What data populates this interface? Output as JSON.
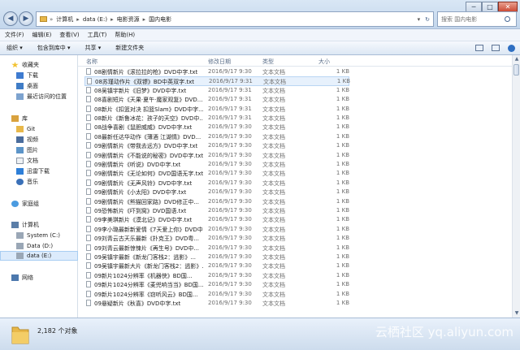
{
  "window": {
    "minimize": "─",
    "maximize": "□",
    "close": "✕"
  },
  "nav": {
    "back": "◀",
    "forward": "▶",
    "dropdown": "▾",
    "refresh": "↻"
  },
  "address": {
    "prefix": "»",
    "segments": [
      "计算机",
      "data (E:)",
      "电影资源",
      "国内电影"
    ],
    "separator": "▸"
  },
  "search": {
    "placeholder": "搜索 国内电影"
  },
  "menu": [
    "文件(F)",
    "编辑(E)",
    "查看(V)",
    "工具(T)",
    "帮助(H)"
  ],
  "toolbar": {
    "organize": "组织 ▾",
    "include": "包含到库中 ▾",
    "share": "共享 ▾",
    "new_folder": "新建文件夹"
  },
  "sidebar": {
    "favorites": "收藏夹",
    "downloads": "下载",
    "desktop": "桌面",
    "recent": "最近访问的位置",
    "libraries": "库",
    "git": "Git",
    "videos": "视频",
    "pictures": "图片",
    "documents": "文档",
    "thunder": "迅雷下载",
    "music": "音乐",
    "homegroup": "家庭组",
    "computer": "计算机",
    "system_c": "System (C:)",
    "data_d": "Data (D:)",
    "data_e": "data (E:)",
    "network": "网络"
  },
  "columns": {
    "name": "名称",
    "date": "修改日期",
    "type": "类型",
    "size": "大小"
  },
  "files": [
    {
      "name": "08剧情新片《滚拉拉的枪》DVD中字.txt",
      "date": "2016/9/17 9:30",
      "type": "文本文档",
      "size": "1 KB"
    },
    {
      "name": "08苏瑾动作片《双镖》BD中英双字.txt",
      "date": "2016/9/17 9:31",
      "type": "文本文档",
      "size": "1 KB"
    },
    {
      "name": "08吴镇宇新片《旧梦》DVD中字.txt",
      "date": "2016/9/17 9:31",
      "type": "文本文档",
      "size": "1 KB"
    },
    {
      "name": "08喜剧短片《天果·夏午·魔家观复》DVD...",
      "date": "2016/9/17 9:31",
      "type": "文本文档",
      "size": "1 KB"
    },
    {
      "name": "08新片《扣篮对决 扣篮Slam》DVD中字...",
      "date": "2016/9/17 9:31",
      "type": "文本文档",
      "size": "1 KB"
    },
    {
      "name": "08新片《新鲁冰花：孩子的天空》DVD中...",
      "date": "2016/9/17 9:31",
      "type": "文本文档",
      "size": "1 KB"
    },
    {
      "name": "08战争喜剧《鼠胆威威》DVD中字.txt",
      "date": "2016/9/17 9:30",
      "type": "文本文档",
      "size": "1 KB"
    },
    {
      "name": "08最新任达华动作《薄酒 江湖情》DVD...",
      "date": "2016/9/17 9:30",
      "type": "文本文档",
      "size": "1 KB"
    },
    {
      "name": "09剧情新片《带我去远方》DVD中字.txt",
      "date": "2016/9/17 9:30",
      "type": "文本文档",
      "size": "1 KB"
    },
    {
      "name": "09剧情新片《不能说的秘密》DVD中字.txt",
      "date": "2016/9/17 9:30",
      "type": "文本文档",
      "size": "1 KB"
    },
    {
      "name": "09剧情新片《听说》DVD中字.txt",
      "date": "2016/9/17 9:30",
      "type": "文本文档",
      "size": "1 KB"
    },
    {
      "name": "09剧情新片《无论如何》DVD国语无字.txt",
      "date": "2016/9/17 9:30",
      "type": "文本文档",
      "size": "1 KB"
    },
    {
      "name": "09剧情新片《无声风铃》DVD中字.txt",
      "date": "2016/9/17 9:30",
      "type": "文本文档",
      "size": "1 KB"
    },
    {
      "name": "09剧情新片《小太阳》DVD中字.txt",
      "date": "2016/9/17 9:30",
      "type": "文本文档",
      "size": "1 KB"
    },
    {
      "name": "09剧情新片《熊猫回家路》DVD修正中...",
      "date": "2016/9/17 9:30",
      "type": "文本文档",
      "size": "1 KB"
    },
    {
      "name": "09恐怖新片《吓到窝》DVD国语.txt",
      "date": "2016/9/17 9:30",
      "type": "文本文档",
      "size": "1 KB"
    },
    {
      "name": "09李美琪新片《漠北记》DVD中字.txt",
      "date": "2016/9/17 9:30",
      "type": "文本文档",
      "size": "1 KB"
    },
    {
      "name": "09李小璐最新新爱情《7天爱上你》DVD中...",
      "date": "2016/9/17 9:30",
      "type": "文本文档",
      "size": "1 KB"
    },
    {
      "name": "09刘青云古天乐最新《扑克王》DVD粤...",
      "date": "2016/9/17 9:30",
      "type": "文本文档",
      "size": "1 KB"
    },
    {
      "name": "09刘青云最新惊悚片《再生号》DVD中...",
      "date": "2016/9/17 9:30",
      "type": "文本文档",
      "size": "1 KB"
    },
    {
      "name": "09吴镇宇最新《新龙门客栈2：逃影》...",
      "date": "2016/9/17 9:30",
      "type": "文本文档",
      "size": "1 KB"
    },
    {
      "name": "09吴镇宇最新大片《新龙门客栈2：逃影》...",
      "date": "2016/9/17 9:30",
      "type": "文本文档",
      "size": "1 KB"
    },
    {
      "name": "09新片1024分辨率《机器侠》BD国...",
      "date": "2016/9/17 9:30",
      "type": "文本文档",
      "size": "1 KB"
    },
    {
      "name": "09新片1024分辨率《麦兜响当当》BD国...",
      "date": "2016/9/17 9:30",
      "type": "文本文档",
      "size": "1 KB"
    },
    {
      "name": "09新片1024分辨率《窃听风云》BD国...",
      "date": "2016/9/17 9:30",
      "type": "文本文档",
      "size": "1 KB"
    },
    {
      "name": "09悬疑新片《秋喜》DVD中字.txt",
      "date": "2016/9/17 9:30",
      "type": "文本文档",
      "size": "1 KB"
    }
  ],
  "status": {
    "count": "2,182 个对象"
  },
  "watermark": "云栖社区 yq.aliyun.com",
  "colors": {
    "accent": "#3b78c4",
    "selection": "#dcebfc",
    "folder": "#e8b84a"
  }
}
